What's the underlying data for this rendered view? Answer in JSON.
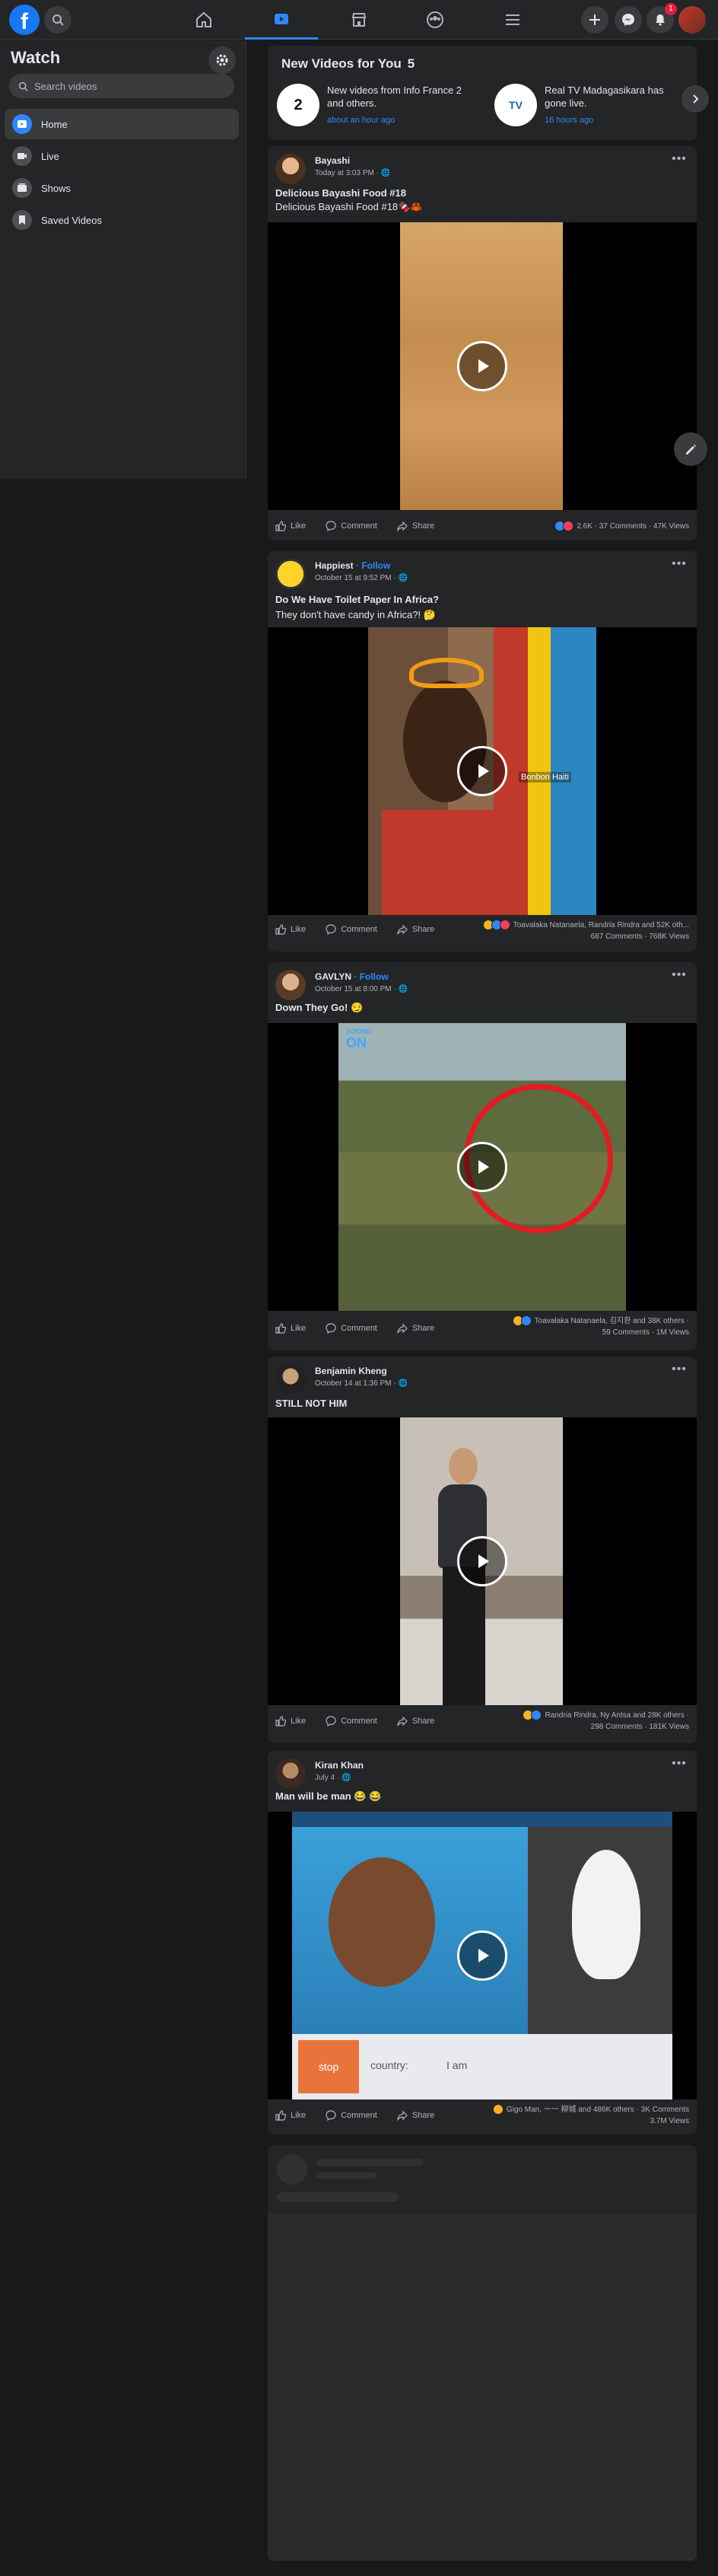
{
  "topbar": {
    "logo_letter": "f",
    "notification_count": "1"
  },
  "sidebar": {
    "title": "Watch",
    "search_placeholder": "Search videos",
    "items": [
      {
        "label": "Home",
        "icon": "watch-home-icon"
      },
      {
        "label": "Live",
        "icon": "live-icon"
      },
      {
        "label": "Shows",
        "icon": "shows-icon"
      },
      {
        "label": "Saved Videos",
        "icon": "bookmark-icon"
      }
    ]
  },
  "new_videos": {
    "title": "New Videos for You",
    "count": "5",
    "items": [
      {
        "thumb": "2",
        "text": "New videos from Info France 2 and others.",
        "time": "about an hour ago"
      },
      {
        "thumb": "TV",
        "text": "Real TV Madagasikara has gone live.",
        "time": "16 hours ago"
      }
    ]
  },
  "posts": [
    {
      "author": "Bayashi",
      "follow": "",
      "time": "Today at 3:03 PM · 🌐",
      "title": "Delicious Bayashi Food #18",
      "subtitle": "Delicious Bayashi Food #18🍫🦀",
      "stats_line1": "2.6K · 37 Comments · 47K Views",
      "stats_line2": ""
    },
    {
      "author": "Happiest",
      "follow": " · Follow",
      "time": "October 15 at 9:52 PM · 🌐",
      "title": "Do We Have Toilet Paper In Africa?",
      "subtitle": "They don't have candy in Africa?! 🤔",
      "stats_line1": "Toavalaka Natanaela, Randria Rindra and 52K oth...",
      "stats_line2": "687 Comments · 768K Views"
    },
    {
      "author": "GAVLYN",
      "follow": " · Follow",
      "time": "October 15 at 8:00 PM · 🌐",
      "title": "Down They Go! 😏",
      "subtitle": "",
      "stats_line1": "Toavalaka Natanaela, 김지환 and 38K others ·",
      "stats_line2": "59 Comments · 1M Views"
    },
    {
      "author": "Benjamin Kheng",
      "follow": "",
      "time": "October 14 at 1:36 PM · 🌐",
      "title": "STILL NOT HIM",
      "subtitle": "",
      "stats_line1": "Randria Rindra, Ny Antsa and 28K others ·",
      "stats_line2": "298 Comments · 181K Views"
    },
    {
      "author": "Kiran Khan",
      "follow": "",
      "time": "July 4 · 🌐",
      "title": "Man will be man 😂 😂",
      "subtitle": "",
      "stats_line1": "Gigo Man, ー一 柳城 and 486K others · 3K Comments",
      "stats_line2": "3.7M Views"
    }
  ],
  "actions": {
    "like": "Like",
    "comment": "Comment",
    "share": "Share"
  },
  "video_overlays": {
    "sticker_text": "Bonbon Haiti",
    "sound_on": "SOUND",
    "sound_on2": "ON",
    "stop_btn": "stop",
    "country": "country:",
    "i_am": "I am"
  },
  "colors": {
    "accent": "#2d88ff",
    "bg": "#18191a",
    "card": "#242526"
  }
}
